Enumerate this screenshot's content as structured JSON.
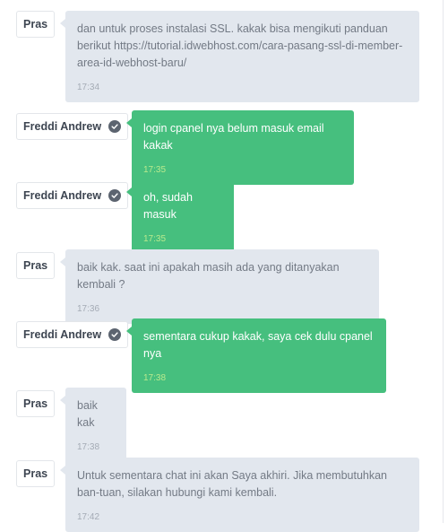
{
  "messages": [
    {
      "sender": "Pras",
      "verified": false,
      "role": "agent",
      "text": "dan untuk proses instalasi SSL. kakak bisa mengikuti panduan berikut https://tutorial.idwebhost.com/cara-pasang-ssl-di-member-area-id-webhost-baru/",
      "time": "17:34"
    },
    {
      "sender": "Freddi Andrew",
      "verified": true,
      "role": "user",
      "text": "login cpanel nya belum masuk email kakak",
      "time": "17:35"
    },
    {
      "sender": "Freddi Andrew",
      "verified": true,
      "role": "user",
      "text": "oh, sudah masuk",
      "time": "17:35"
    },
    {
      "sender": "Pras",
      "verified": false,
      "role": "agent",
      "text": "baik kak. saat ini apakah masih ada yang ditanyakan kembali ?",
      "time": "17:36"
    },
    {
      "sender": "Freddi Andrew",
      "verified": true,
      "role": "user",
      "text": "sementara cukup kakak, saya cek dulu cpanel nya",
      "time": "17:38"
    },
    {
      "sender": "Pras",
      "verified": false,
      "role": "agent",
      "text": "baik kak",
      "time": "17:38"
    },
    {
      "sender": "Pras",
      "verified": false,
      "role": "agent",
      "text": "Untuk sementara chat ini akan Saya akhiri. Jika membutuhkan ban-tuan, silakan hubungi kami kembali.",
      "time": "17:42"
    }
  ]
}
